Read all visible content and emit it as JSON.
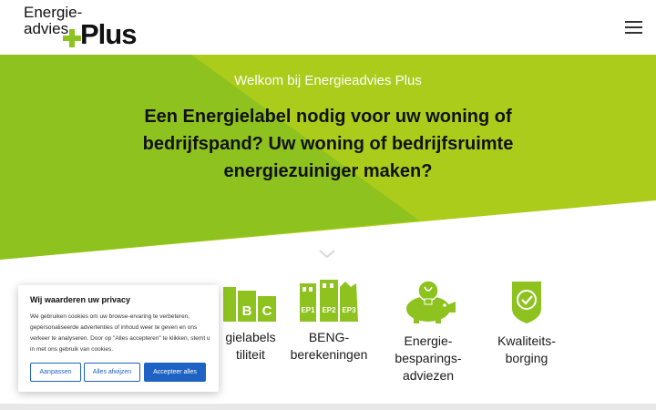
{
  "header": {
    "logo_line1": "Energie-",
    "logo_line2": "advies",
    "logo_plus": "Plus",
    "brand_color": "#8dc21f"
  },
  "hero": {
    "welcome": "Welkom bij Energieadvies Plus",
    "title": "Een Energielabel nodig voor uw woning of bedrijfspand? Uw woning of bedrijfsruimte energiezuiniger maken?",
    "colors": {
      "dark_green": "#8dc21f",
      "light_green": "#abcc1a"
    }
  },
  "services": [
    {
      "lines": [
        "gielabels",
        "tiliteit"
      ],
      "icon": "energy-label-icon",
      "visible_letters": [
        "B",
        "C"
      ]
    },
    {
      "lines": [
        "BENG-",
        "berekeningen"
      ],
      "icon": "beng-ep-icon",
      "tags": [
        "EP1",
        "EP2",
        "EP3"
      ]
    },
    {
      "lines": [
        "Energie-",
        "besparings-",
        "adviezen"
      ],
      "icon": "piggy-bank-bulb-icon"
    },
    {
      "lines": [
        "Kwaliteits-",
        "borging"
      ],
      "icon": "quality-shield-icon"
    }
  ],
  "cookie": {
    "title": "Wij waarderen uw privacy",
    "text": "We gebruiken cookies om uw browse-ervaring te verbeteren, gepersonaliseerde advertenties of inhoud weer te geven en ons verkeer te analyseren. Door op \"Alles accepteren\" te klikken, stemt u in met ons gebruik van cookies.",
    "btn_customize": "Aanpassen",
    "btn_reject": "Alles afwijzen",
    "btn_accept": "Accepteer alles",
    "accent": "#1e62c4"
  }
}
